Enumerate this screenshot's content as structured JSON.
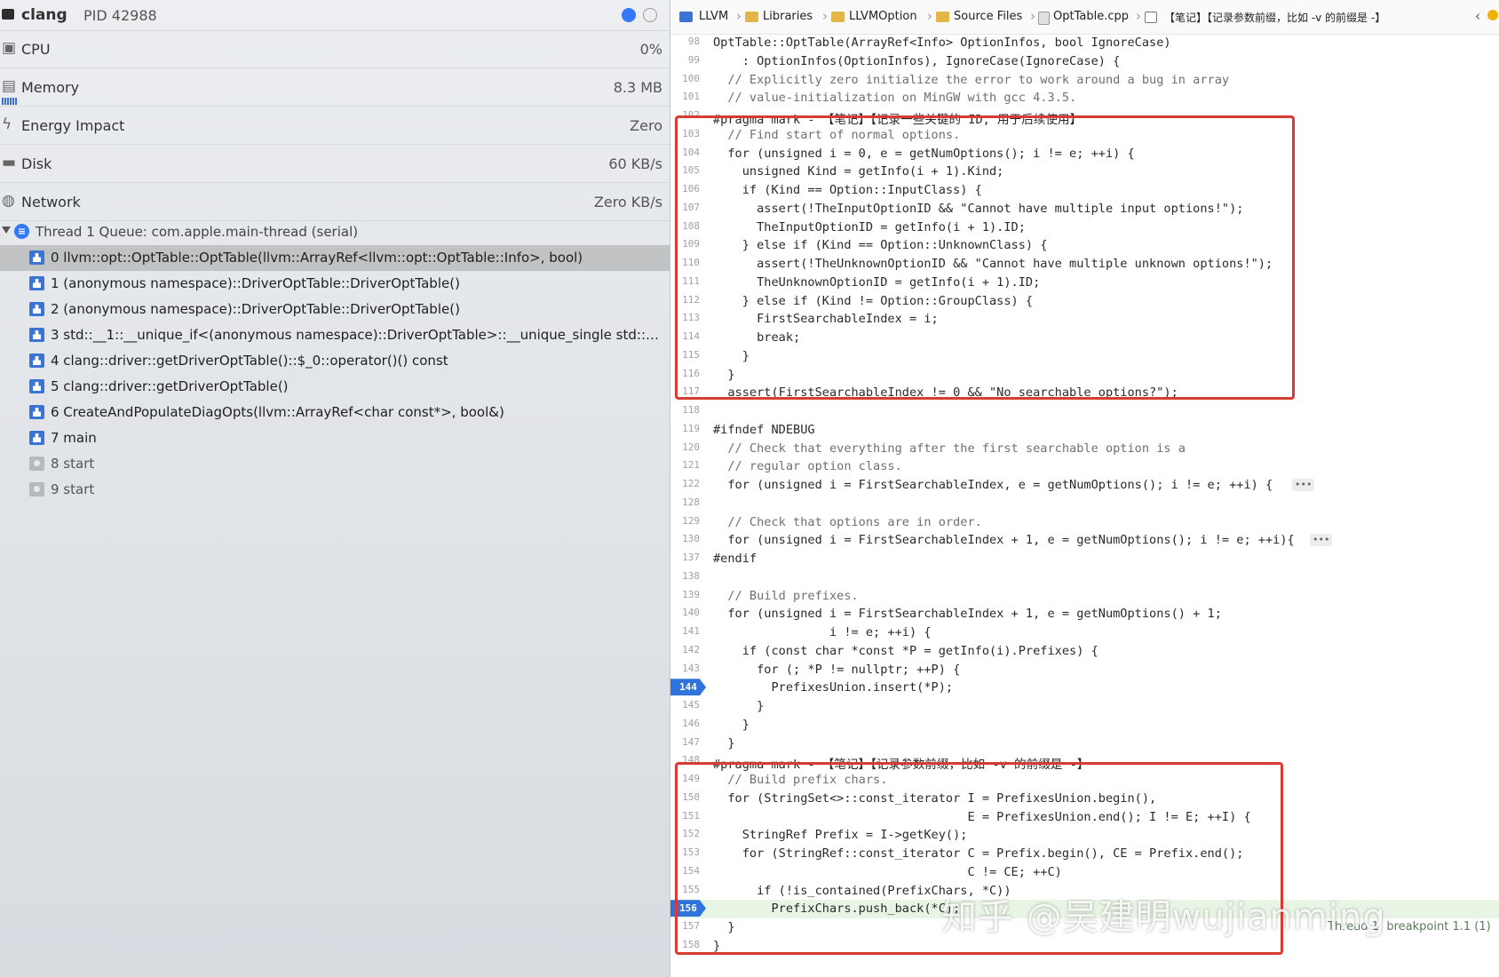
{
  "debug_nav": {
    "process_name": "clang",
    "process_pid": "PID 42988",
    "gauges": [
      {
        "label": "CPU",
        "value": "0%",
        "icon": "cpu-icon"
      },
      {
        "label": "Memory",
        "value": "8.3 MB",
        "icon": "memory-icon"
      },
      {
        "label": "Energy Impact",
        "value": "Zero",
        "icon": "bolt-icon"
      },
      {
        "label": "Disk",
        "value": "60 KB/s",
        "icon": "disk-icon"
      },
      {
        "label": "Network",
        "value": "Zero KB/s",
        "icon": "globe-icon"
      }
    ],
    "thread_label": "Thread 1 Queue: com.apple.main-thread (serial)",
    "frames": [
      "0 llvm::opt::OptTable::OptTable(llvm::ArrayRef<llvm::opt::OptTable::Info>, bool)",
      "1 (anonymous namespace)::DriverOptTable::DriverOptTable()",
      "2 (anonymous namespace)::DriverOptTable::DriverOptTable()",
      "3 std::__1::__unique_if<(anonymous namespace)::DriverOptTable>::__unique_single std::__1::...",
      "4 clang::driver::getDriverOptTable()::$_0::operator()() const",
      "5 clang::driver::getDriverOptTable()",
      "6 CreateAndPopulateDiagOpts(llvm::ArrayRef<char const*>, bool&)",
      "7 main",
      "8 start",
      "9 start"
    ]
  },
  "jumpbar": {
    "crumbs": [
      "LLVM",
      "Libraries",
      "LLVMOption",
      "Source Files",
      "OptTable.cpp",
      "【笔记】【记录参数前缀，比如 -v 的前缀是 -】"
    ]
  },
  "code": {
    "lines": [
      {
        "n": "98",
        "t": "OptTable::OptTable(ArrayRef<Info> OptionInfos, bool IgnoreCase)"
      },
      {
        "n": "99",
        "t": "    : OptionInfos(OptionInfos), IgnoreCase(IgnoreCase) {"
      },
      {
        "n": "100",
        "t": "  // Explicitly zero initialize the error to work around a bug in array"
      },
      {
        "n": "101",
        "t": "  // value-initialization on MinGW with gcc 4.3.5."
      },
      {
        "n": "102",
        "t": "#pragma mark - 【笔记】【记录一些关键的 ID, 用于后续使用】"
      },
      {
        "n": "103",
        "t": "  // Find start of normal options."
      },
      {
        "n": "104",
        "t": "  for (unsigned i = 0, e = getNumOptions(); i != e; ++i) {"
      },
      {
        "n": "105",
        "t": "    unsigned Kind = getInfo(i + 1).Kind;"
      },
      {
        "n": "106",
        "t": "    if (Kind == Option::InputClass) {"
      },
      {
        "n": "107",
        "t": "      assert(!TheInputOptionID && \"Cannot have multiple input options!\");"
      },
      {
        "n": "108",
        "t": "      TheInputOptionID = getInfo(i + 1).ID;"
      },
      {
        "n": "109",
        "t": "    } else if (Kind == Option::UnknownClass) {"
      },
      {
        "n": "110",
        "t": "      assert(!TheUnknownOptionID && \"Cannot have multiple unknown options!\");"
      },
      {
        "n": "111",
        "t": "      TheUnknownOptionID = getInfo(i + 1).ID;"
      },
      {
        "n": "112",
        "t": "    } else if (Kind != Option::GroupClass) {"
      },
      {
        "n": "113",
        "t": "      FirstSearchableIndex = i;"
      },
      {
        "n": "114",
        "t": "      break;"
      },
      {
        "n": "115",
        "t": "    }"
      },
      {
        "n": "116",
        "t": "  }"
      },
      {
        "n": "117",
        "t": "  assert(FirstSearchableIndex != 0 && \"No searchable options?\");"
      },
      {
        "n": "118",
        "t": ""
      },
      {
        "n": "119",
        "t": "#ifndef NDEBUG"
      },
      {
        "n": "120",
        "t": "  // Check that everything after the first searchable option is a"
      },
      {
        "n": "121",
        "t": "  // regular option class."
      },
      {
        "n": "122",
        "t": "  for (unsigned i = FirstSearchableIndex, e = getNumOptions(); i != e; ++i) {"
      },
      {
        "n": "128",
        "t": ""
      },
      {
        "n": "129",
        "t": "  // Check that options are in order."
      },
      {
        "n": "130",
        "t": "  for (unsigned i = FirstSearchableIndex + 1, e = getNumOptions(); i != e; ++i){"
      },
      {
        "n": "137",
        "t": "#endif"
      },
      {
        "n": "138",
        "t": ""
      },
      {
        "n": "139",
        "t": "  // Build prefixes."
      },
      {
        "n": "140",
        "t": "  for (unsigned i = FirstSearchableIndex + 1, e = getNumOptions() + 1;"
      },
      {
        "n": "141",
        "t": "                i != e; ++i) {"
      },
      {
        "n": "142",
        "t": "    if (const char *const *P = getInfo(i).Prefixes) {"
      },
      {
        "n": "143",
        "t": "      for (; *P != nullptr; ++P) {"
      },
      {
        "n": "144",
        "t": "        PrefixesUnion.insert(*P);"
      },
      {
        "n": "145",
        "t": "      }"
      },
      {
        "n": "146",
        "t": "    }"
      },
      {
        "n": "147",
        "t": "  }"
      },
      {
        "n": "148",
        "t": "#pragma mark - 【笔记】【记录参数前缀，比如 -v 的前缀是 -】"
      },
      {
        "n": "149",
        "t": "  // Build prefix chars."
      },
      {
        "n": "150",
        "t": "  for (StringSet<>::const_iterator I = PrefixesUnion.begin(),"
      },
      {
        "n": "151",
        "t": "                                   E = PrefixesUnion.end(); I != E; ++I) {"
      },
      {
        "n": "152",
        "t": "    StringRef Prefix = I->getKey();"
      },
      {
        "n": "153",
        "t": "    for (StringRef::const_iterator C = Prefix.begin(), CE = Prefix.end();"
      },
      {
        "n": "154",
        "t": "                                   C != CE; ++C)"
      },
      {
        "n": "155",
        "t": "      if (!is_contained(PrefixChars, *C))"
      },
      {
        "n": "156",
        "t": "        PrefixChars.push_back(*C);"
      },
      {
        "n": "157",
        "t": "  }"
      },
      {
        "n": "158",
        "t": "}"
      }
    ],
    "fold_marker": "•••",
    "breakpoint_lines": [
      "144",
      "156"
    ],
    "thread_hint": "Thread 1: breakpoint 1.1 (1)"
  },
  "watermark": "知乎 @吴建明wujianming",
  "colors": {
    "breakpoint": "#2f73dc",
    "annotation_box": "#d83b33",
    "selected_frame": "#c1c2c3"
  }
}
